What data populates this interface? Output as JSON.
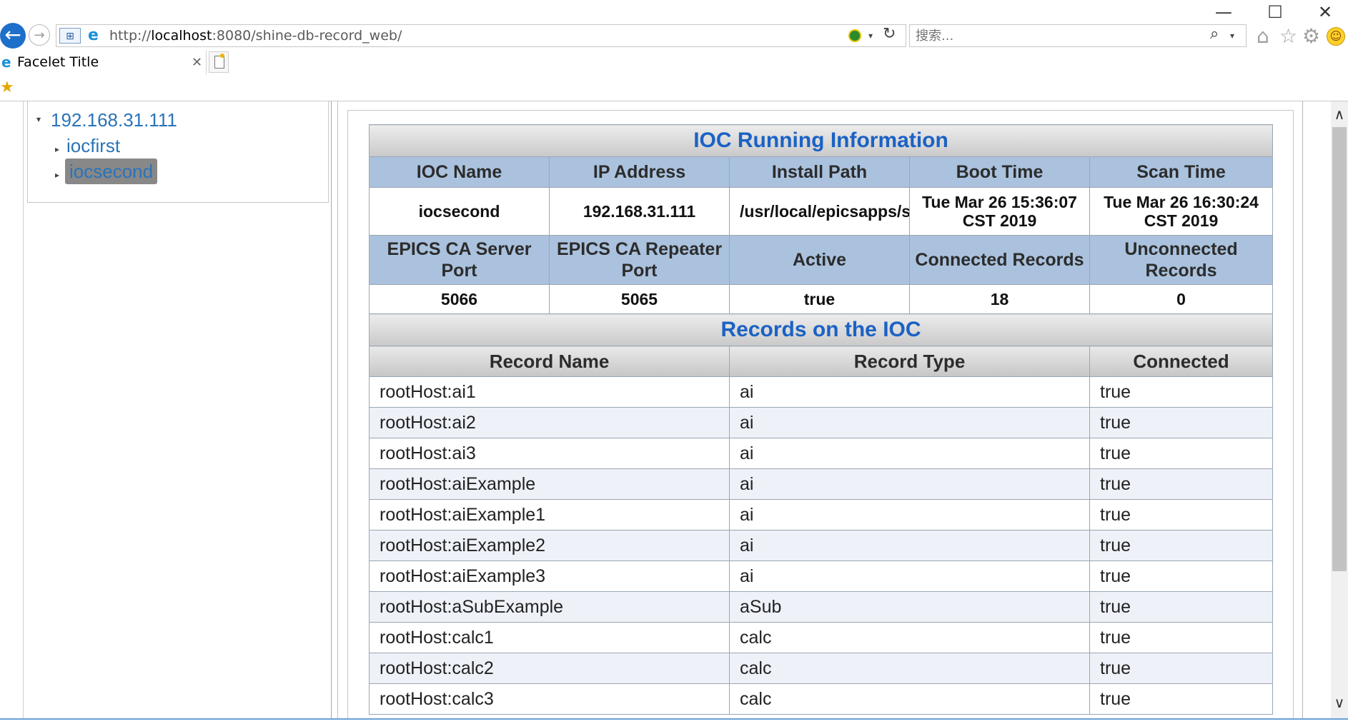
{
  "browser": {
    "url_prefix": "http://",
    "url_host": "localhost",
    "url_rest": ":8080/shine-db-record_web/",
    "search_placeholder": "搜索...",
    "tab_title": "Facelet Title",
    "window_controls": {
      "minimize": "—",
      "maximize": "☐",
      "close": "✕"
    }
  },
  "tree": {
    "root": "192.168.31.111",
    "children": [
      "iocfirst",
      "iocsecond"
    ],
    "selected": "iocsecond"
  },
  "ioc_info": {
    "caption": "IOC Running Information",
    "headers": [
      "IOC Name",
      "IP Address",
      "Install Path",
      "Boot Time",
      "Scan Time"
    ],
    "values": [
      "iocsecond",
      "192.168.31.111",
      "/usr/local/epicsapps/s",
      "Tue Mar 26 15:36:07 CST 2019",
      "Tue Mar 26 16:30:24 CST 2019"
    ],
    "headers2": [
      "EPICS CA Server Port",
      "EPICS CA Repeater Port",
      "Active",
      "Connected Records",
      "Unconnected Records"
    ],
    "values2": [
      "5066",
      "5065",
      "true",
      "18",
      "0"
    ]
  },
  "records": {
    "caption": "Records on the IOC",
    "headers": [
      "Record Name",
      "Record Type",
      "Connected"
    ],
    "rows": [
      [
        "rootHost:ai1",
        "ai",
        "true"
      ],
      [
        "rootHost:ai2",
        "ai",
        "true"
      ],
      [
        "rootHost:ai3",
        "ai",
        "true"
      ],
      [
        "rootHost:aiExample",
        "ai",
        "true"
      ],
      [
        "rootHost:aiExample1",
        "ai",
        "true"
      ],
      [
        "rootHost:aiExample2",
        "ai",
        "true"
      ],
      [
        "rootHost:aiExample3",
        "ai",
        "true"
      ],
      [
        "rootHost:aSubExample",
        "aSub",
        "true"
      ],
      [
        "rootHost:calc1",
        "calc",
        "true"
      ],
      [
        "rootHost:calc2",
        "calc",
        "true"
      ],
      [
        "rootHost:calc3",
        "calc",
        "true"
      ]
    ]
  },
  "colors": {
    "accent": "#1b62c4",
    "header_bg": "#aac2de",
    "tree_link": "#2a73b8"
  }
}
